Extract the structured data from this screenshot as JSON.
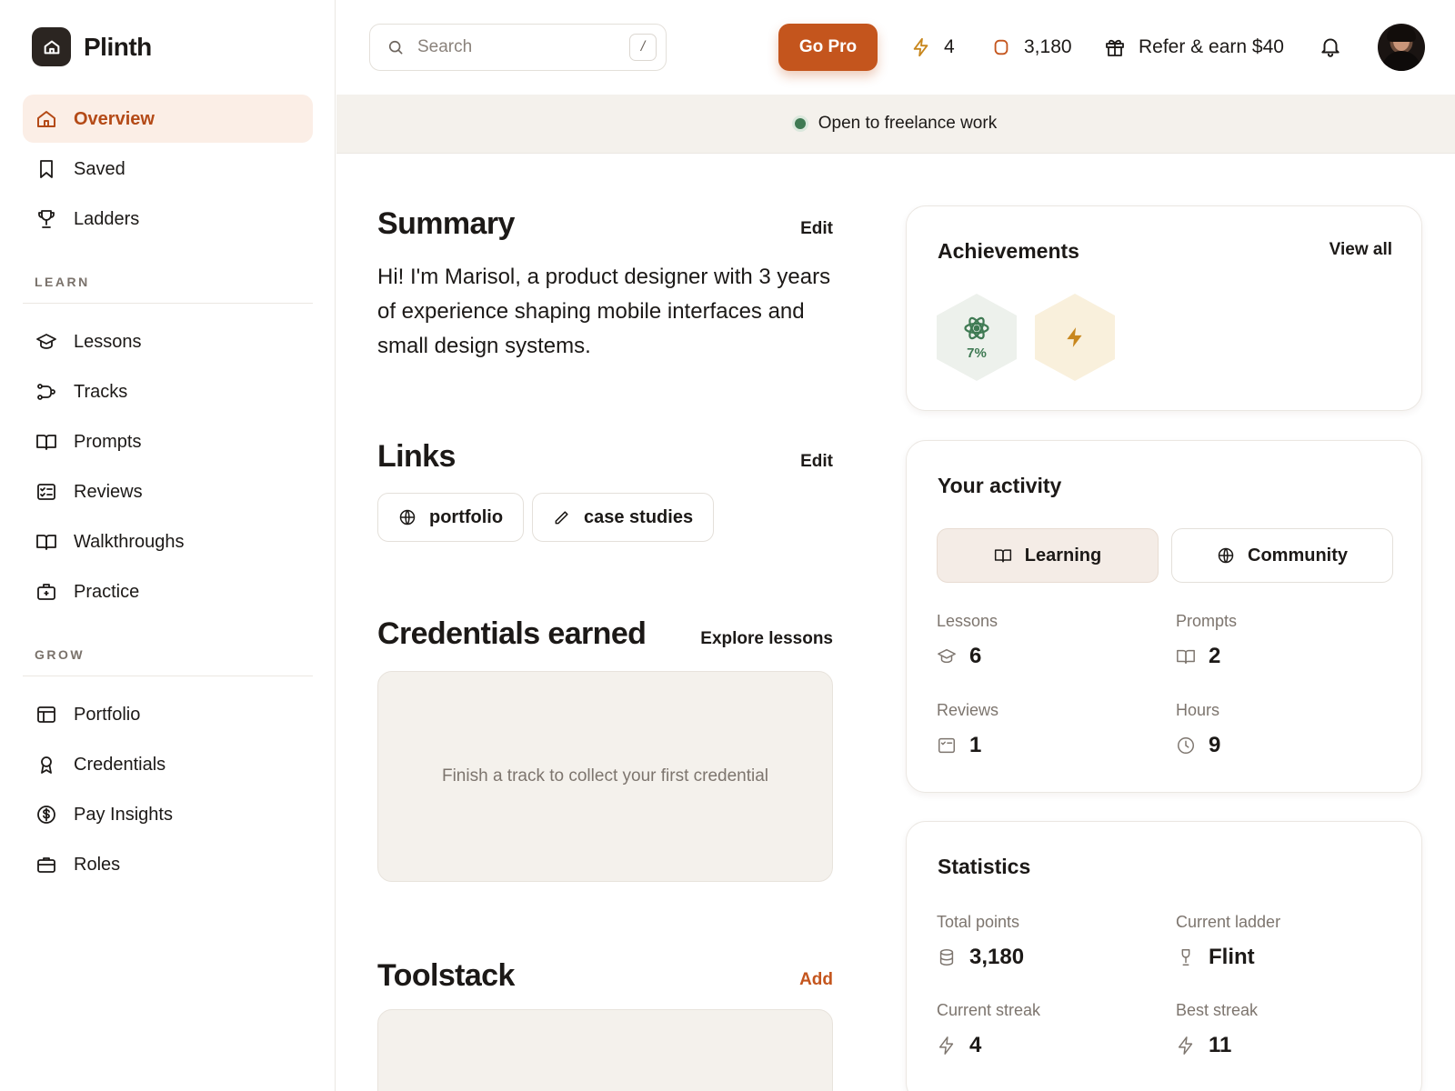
{
  "app": {
    "name": "Plinth"
  },
  "sidebar": {
    "primary": [
      {
        "label": "Overview",
        "icon": "home-icon",
        "active": true
      },
      {
        "label": "Saved",
        "icon": "bookmark-icon"
      },
      {
        "label": "Ladders",
        "icon": "trophy-icon"
      }
    ],
    "learn_label": "LEARN",
    "learn": [
      {
        "label": "Lessons",
        "icon": "graduation-cap-icon"
      },
      {
        "label": "Tracks",
        "icon": "route-icon"
      },
      {
        "label": "Prompts",
        "icon": "book-open-icon"
      },
      {
        "label": "Reviews",
        "icon": "checklist-icon"
      },
      {
        "label": "Walkthroughs",
        "icon": "book-open-icon"
      },
      {
        "label": "Practice",
        "icon": "first-aid-kit-icon"
      }
    ],
    "grow_label": "GROW",
    "grow": [
      {
        "label": "Portfolio",
        "icon": "layout-icon"
      },
      {
        "label": "Credentials",
        "icon": "award-icon"
      },
      {
        "label": "Pay Insights",
        "icon": "dollar-circle-icon"
      },
      {
        "label": "Roles",
        "icon": "briefcase-icon"
      }
    ]
  },
  "topbar": {
    "search_placeholder": "Search",
    "search_shortcut": "/",
    "go_pro": "Go Pro",
    "streak": "4",
    "points": "3,180",
    "refer": "Refer & earn $40"
  },
  "banner": {
    "status": "Open to freelance work",
    "dot_color": "#3f7a53"
  },
  "summary": {
    "title": "Summary",
    "action": "Edit",
    "text": "Hi! I'm Marisol, a product designer with 3 years of experience shaping mobile interfaces and small design systems."
  },
  "links": {
    "title": "Links",
    "action": "Edit",
    "items": [
      {
        "label": "portfolio",
        "icon": "globe-icon"
      },
      {
        "label": "case studies",
        "icon": "pencil-icon"
      }
    ]
  },
  "credentials": {
    "title": "Credentials earned",
    "action": "Explore lessons",
    "empty": "Finish a track to collect your first credential"
  },
  "toolstack": {
    "title": "Toolstack",
    "action": "Add"
  },
  "achievements": {
    "title": "Achievements",
    "action": "View all",
    "badges": [
      {
        "icon": "atom-icon",
        "progress": "7%"
      },
      {
        "icon": "lightning-icon"
      }
    ]
  },
  "activity": {
    "title": "Your activity",
    "tabs": [
      {
        "label": "Learning",
        "icon": "book-open-icon",
        "active": true
      },
      {
        "label": "Community",
        "icon": "globe-icon"
      }
    ],
    "stats": [
      {
        "label": "Lessons",
        "value": "6",
        "icon": "graduation-cap-icon"
      },
      {
        "label": "Prompts",
        "value": "2",
        "icon": "book-open-icon"
      },
      {
        "label": "Reviews",
        "value": "1",
        "icon": "checklist-icon"
      },
      {
        "label": "Hours",
        "value": "9",
        "icon": "clock-icon"
      }
    ]
  },
  "statistics": {
    "title": "Statistics",
    "stats": [
      {
        "label": "Total points",
        "value": "3,180",
        "icon": "coins-icon"
      },
      {
        "label": "Current ladder",
        "value": "Flint",
        "icon": "trophy-icon"
      },
      {
        "label": "Current streak",
        "value": "4",
        "icon": "lightning-icon"
      },
      {
        "label": "Best streak",
        "value": "11",
        "icon": "lightning-icon"
      }
    ]
  },
  "colors": {
    "accent": "#c4551d",
    "accent_soft": "#fbeee6",
    "success": "#3f7a53",
    "gold": "#c8871d"
  }
}
